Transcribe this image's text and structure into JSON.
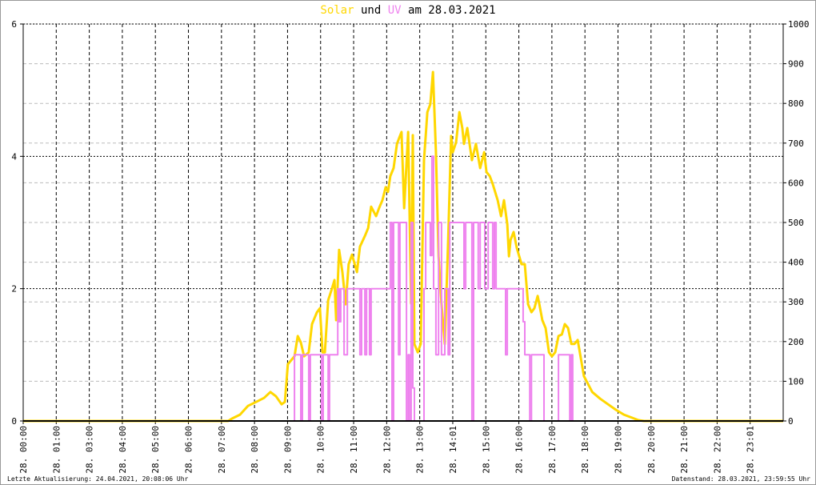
{
  "title": {
    "solar": "Solar",
    "und": "und",
    "uv": "UV",
    "rest": "am 28.03.2021"
  },
  "footer": {
    "left": "Letzte Aktualisierung: 24.04.2021, 20:08:06 Uhr",
    "right": "Datenstand: 28.03.2021, 23:59:55 Uhr"
  },
  "colors": {
    "solar": "#ffd700",
    "uv": "#ee82ee",
    "grid_major": "#000000",
    "grid_minor": "#bbbbbb"
  },
  "chart_data": {
    "type": "line",
    "title": "Solar und UV am 28.03.2021",
    "x_tick_labels": [
      "28. 00:00",
      "28. 01:00",
      "28. 03:00",
      "28. 04:00",
      "28. 05:00",
      "28. 06:00",
      "28. 07:00",
      "28. 08:00",
      "28. 09:00",
      "28. 10:00",
      "28. 11:00",
      "28. 12:00",
      "28. 13:00",
      "28. 14:01",
      "28. 15:00",
      "28. 16:00",
      "28. 17:00",
      "28. 18:00",
      "28. 19:00",
      "28. 20:00",
      "28. 21:00",
      "28. 22:00",
      "28. 23:01"
    ],
    "xlim": [
      0,
      23
    ],
    "y_left": {
      "label": "UV",
      "ylim": [
        0,
        6
      ],
      "ticks": [
        0,
        2,
        4,
        6
      ]
    },
    "y_right": {
      "label": "Solar",
      "ylim": [
        0,
        1000
      ],
      "ticks": [
        0,
        100,
        200,
        300,
        400,
        500,
        600,
        700,
        800,
        900,
        1000
      ]
    },
    "grid": true,
    "series": [
      {
        "name": "Solar",
        "axis": "right",
        "step": false,
        "points": [
          [
            0,
            0
          ],
          [
            6.2,
            0
          ],
          [
            6.32,
            6
          ],
          [
            6.56,
            16
          ],
          [
            6.8,
            38
          ],
          [
            7.05,
            48
          ],
          [
            7.29,
            58
          ],
          [
            7.48,
            73
          ],
          [
            7.65,
            62
          ],
          [
            7.82,
            42
          ],
          [
            7.92,
            48
          ],
          [
            8.01,
            143
          ],
          [
            8.21,
            163
          ],
          [
            8.31,
            214
          ],
          [
            8.4,
            198
          ],
          [
            8.5,
            163
          ],
          [
            8.64,
            173
          ],
          [
            8.74,
            244
          ],
          [
            8.89,
            274
          ],
          [
            8.98,
            284
          ],
          [
            9.06,
            173
          ],
          [
            9.13,
            173
          ],
          [
            9.23,
            304
          ],
          [
            9.35,
            335
          ],
          [
            9.42,
            355
          ],
          [
            9.47,
            254
          ],
          [
            9.56,
            431
          ],
          [
            9.66,
            375
          ],
          [
            9.76,
            294
          ],
          [
            9.85,
            395
          ],
          [
            9.95,
            419
          ],
          [
            10.1,
            375
          ],
          [
            10.19,
            439
          ],
          [
            10.34,
            466
          ],
          [
            10.44,
            486
          ],
          [
            10.53,
            540
          ],
          [
            10.68,
            516
          ],
          [
            10.77,
            536
          ],
          [
            10.87,
            556
          ],
          [
            10.97,
            589
          ],
          [
            11.04,
            577
          ],
          [
            11.11,
            617
          ],
          [
            11.21,
            637
          ],
          [
            11.31,
            698
          ],
          [
            11.4,
            718
          ],
          [
            11.45,
            728
          ],
          [
            11.53,
            536
          ],
          [
            11.65,
            728
          ],
          [
            11.74,
            296
          ],
          [
            11.79,
            720
          ],
          [
            11.84,
            194
          ],
          [
            11.94,
            173
          ],
          [
            12.03,
            194
          ],
          [
            12.13,
            657
          ],
          [
            12.23,
            778
          ],
          [
            12.32,
            798
          ],
          [
            12.4,
            879
          ],
          [
            12.49,
            678
          ],
          [
            12.57,
            415
          ],
          [
            12.66,
            294
          ],
          [
            12.76,
            194
          ],
          [
            12.86,
            456
          ],
          [
            12.95,
            718
          ],
          [
            13.0,
            677
          ],
          [
            13.1,
            702
          ],
          [
            13.2,
            778
          ],
          [
            13.29,
            738
          ],
          [
            13.34,
            698
          ],
          [
            13.44,
            738
          ],
          [
            13.58,
            657
          ],
          [
            13.7,
            698
          ],
          [
            13.83,
            637
          ],
          [
            13.95,
            677
          ],
          [
            14.02,
            627
          ],
          [
            14.12,
            617
          ],
          [
            14.21,
            597
          ],
          [
            14.36,
            556
          ],
          [
            14.46,
            516
          ],
          [
            14.55,
            556
          ],
          [
            14.65,
            496
          ],
          [
            14.7,
            415
          ],
          [
            14.75,
            456
          ],
          [
            14.84,
            476
          ],
          [
            14.94,
            435
          ],
          [
            15.08,
            395
          ],
          [
            15.18,
            395
          ],
          [
            15.28,
            294
          ],
          [
            15.38,
            274
          ],
          [
            15.47,
            284
          ],
          [
            15.57,
            315
          ],
          [
            15.62,
            294
          ],
          [
            15.71,
            254
          ],
          [
            15.81,
            234
          ],
          [
            15.91,
            173
          ],
          [
            16.0,
            163
          ],
          [
            16.1,
            173
          ],
          [
            16.2,
            214
          ],
          [
            16.3,
            218
          ],
          [
            16.39,
            244
          ],
          [
            16.49,
            234
          ],
          [
            16.59,
            194
          ],
          [
            16.68,
            194
          ],
          [
            16.78,
            204
          ],
          [
            16.97,
            113
          ],
          [
            17.22,
            73
          ],
          [
            17.46,
            56
          ],
          [
            17.7,
            42
          ],
          [
            17.94,
            28
          ],
          [
            18.18,
            16
          ],
          [
            18.43,
            8
          ],
          [
            18.62,
            2
          ],
          [
            18.79,
            0
          ],
          [
            23,
            0
          ]
        ]
      },
      {
        "name": "UV",
        "axis": "left",
        "step": true,
        "points": [
          [
            0,
            0
          ],
          [
            8.21,
            1
          ],
          [
            8.4,
            0
          ],
          [
            8.45,
            1
          ],
          [
            8.64,
            0
          ],
          [
            8.69,
            1
          ],
          [
            9.03,
            0
          ],
          [
            9.08,
            1
          ],
          [
            9.23,
            0
          ],
          [
            9.27,
            1
          ],
          [
            9.52,
            2
          ],
          [
            9.56,
            1.5
          ],
          [
            9.61,
            2
          ],
          [
            9.71,
            1
          ],
          [
            9.81,
            2
          ],
          [
            10.19,
            1
          ],
          [
            10.24,
            2
          ],
          [
            10.34,
            1
          ],
          [
            10.39,
            2
          ],
          [
            10.48,
            1
          ],
          [
            10.53,
            2
          ],
          [
            11.11,
            3
          ],
          [
            11.16,
            0
          ],
          [
            11.21,
            3
          ],
          [
            11.36,
            1
          ],
          [
            11.4,
            3
          ],
          [
            11.6,
            0
          ],
          [
            11.65,
            1
          ],
          [
            11.69,
            0
          ],
          [
            11.74,
            3
          ],
          [
            11.79,
            0.5
          ],
          [
            11.84,
            0
          ],
          [
            12.13,
            2
          ],
          [
            12.18,
            3
          ],
          [
            12.32,
            2.5
          ],
          [
            12.37,
            4
          ],
          [
            12.42,
            2
          ],
          [
            12.49,
            1
          ],
          [
            12.57,
            3
          ],
          [
            12.66,
            1
          ],
          [
            12.76,
            2
          ],
          [
            12.86,
            1
          ],
          [
            12.91,
            3
          ],
          [
            13.34,
            2
          ],
          [
            13.39,
            3
          ],
          [
            13.58,
            0
          ],
          [
            13.63,
            3
          ],
          [
            13.77,
            2
          ],
          [
            13.83,
            3
          ],
          [
            13.97,
            2
          ],
          [
            14.07,
            3
          ],
          [
            14.21,
            2
          ],
          [
            14.26,
            3
          ],
          [
            14.31,
            2
          ],
          [
            14.6,
            1
          ],
          [
            14.65,
            2
          ],
          [
            15.13,
            1.5
          ],
          [
            15.18,
            1
          ],
          [
            15.33,
            0
          ],
          [
            15.38,
            1
          ],
          [
            15.76,
            0
          ],
          [
            16.2,
            1
          ],
          [
            16.54,
            0
          ],
          [
            16.59,
            1
          ],
          [
            16.63,
            0
          ],
          [
            23,
            0
          ]
        ]
      }
    ]
  }
}
